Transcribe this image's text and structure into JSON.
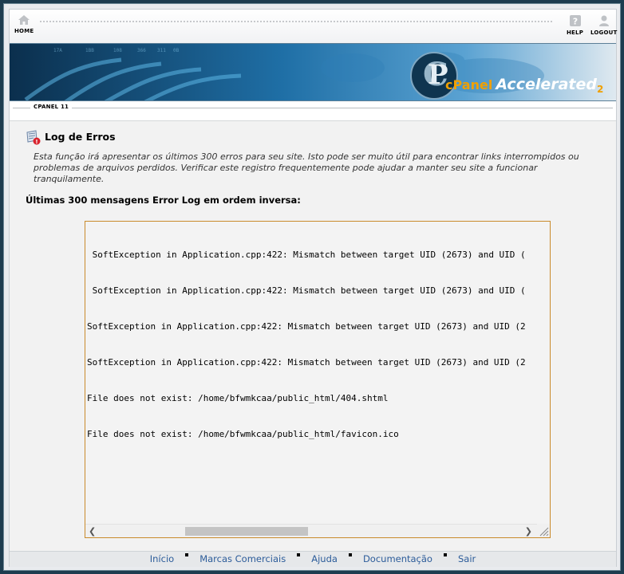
{
  "topbar": {
    "home_label": "HOME",
    "help_label": "HELP",
    "logout_label": "LOGOUT"
  },
  "banner": {
    "logo_cpanel": "cPanel",
    "logo_accelerated": "Accelerated",
    "logo_version": "2"
  },
  "version_label": "CPANEL 11",
  "page": {
    "title": "Log de Erros",
    "description": "Esta função irá apresentar os últimos 300 erros para seu site. Isto pode ser muito útil para encontrar links interrompidos ou problemas de arquivos perdidos. Verificar este registro frequentemente pode ajudar a manter seu site a funcionar tranquilamente.",
    "subheading": "Últimas 300 mensagens Error Log em ordem inversa:"
  },
  "log_lines": [
    " SoftException in Application.cpp:422: Mismatch between target UID (2673) and UID (",
    " SoftException in Application.cpp:422: Mismatch between target UID (2673) and UID (",
    "SoftException in Application.cpp:422: Mismatch between target UID (2673) and UID (2",
    "SoftException in Application.cpp:422: Mismatch between target UID (2673) and UID (2",
    "File does not exist: /home/bfwmkcaa/public_html/404.shtml",
    "File does not exist: /home/bfwmkcaa/public_html/favicon.ico"
  ],
  "footer": {
    "links": [
      "Início",
      "Marcas Comerciais",
      "Ajuda",
      "Documentação",
      "Sair"
    ]
  },
  "colors": {
    "link": "#2c5c9a",
    "log_border": "#c98a2b",
    "banner_accent": "#f0a000"
  }
}
